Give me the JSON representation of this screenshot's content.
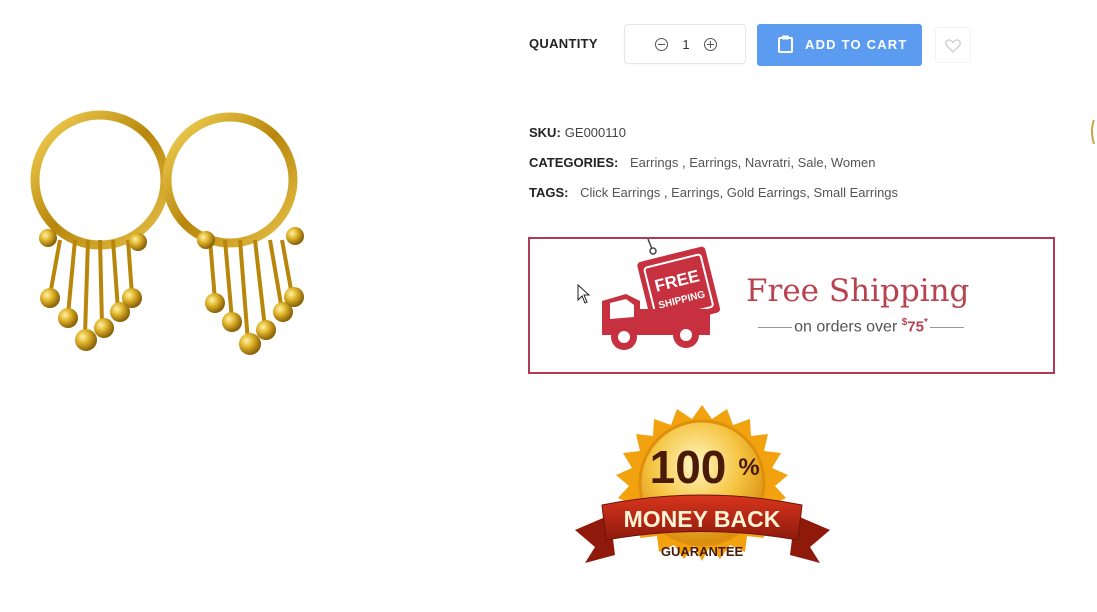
{
  "product": {
    "image_alt": "Gold hoop earrings with hanging bead chains"
  },
  "quantity": {
    "label": "QUANTITY",
    "value": "1"
  },
  "actions": {
    "add_to_cart": "ADD TO CART"
  },
  "meta": {
    "sku_label": "SKU:",
    "sku_value": "GE000110",
    "categories_label": "CATEGORIES:",
    "categories": [
      "Earrings",
      "Earrings",
      "Navratri",
      "Sale",
      "Women"
    ],
    "tags_label": "TAGS:",
    "tags": [
      "Click Earrings",
      "Earrings",
      "Gold Earrings",
      "Small Earrings"
    ]
  },
  "shipping_banner": {
    "truck_text_1": "FREE",
    "truck_text_2": "SHIPPING",
    "title": "Free Shipping",
    "subtitle": "on orders over",
    "currency": "$",
    "amount": "75",
    "asterisk": "*"
  },
  "guarantee_badge": {
    "percent": "100",
    "percent_sign": "%",
    "line1": "MONEY BACK",
    "line2": "GUARANTEE"
  },
  "colors": {
    "accent_button": "#5b9bf0",
    "banner_border": "#b23a52",
    "banner_red": "#c7313f",
    "gold": "#d4a017"
  },
  "icons": {
    "cart": "clipboard-cart-icon",
    "wishlist": "heart-icon",
    "minus": "minus-circle-icon",
    "plus": "plus-circle-icon"
  }
}
